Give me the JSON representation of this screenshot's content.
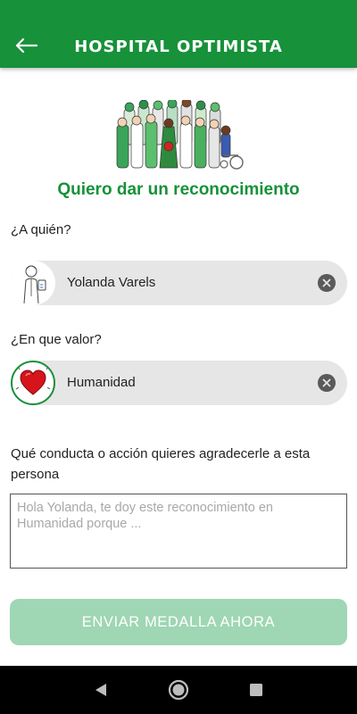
{
  "app_bar": {
    "title": "HOSPITAL OPTIMISTA",
    "back_icon": "arrow-left-icon",
    "background": "#17913a"
  },
  "header": {
    "headline": "Quiero dar un reconocimiento"
  },
  "recipient": {
    "label": "¿A quién?",
    "selected": "Yolanda Varels",
    "avatar_icon": "doctor-avatar-icon",
    "clear_icon": "clear-icon"
  },
  "value": {
    "label": "¿En que valor?",
    "selected": "Humanidad",
    "avatar_icon": "heart-icon",
    "clear_icon": "clear-icon"
  },
  "message": {
    "prompt": "Qué conducta o acción quieres agradecerle a esta persona",
    "placeholder": "Hola Yolanda, te doy este reconocimiento en Humanidad porque ...",
    "value": ""
  },
  "submit": {
    "label": "ENVIAR MEDALLA AHORA",
    "color": "#9fd6b4"
  },
  "system_nav": {
    "back_icon": "nav-back-icon",
    "home_icon": "nav-home-icon",
    "recents_icon": "nav-recents-icon"
  },
  "colors": {
    "brand_green": "#17913a",
    "chip_grey": "#e6e6e6"
  }
}
